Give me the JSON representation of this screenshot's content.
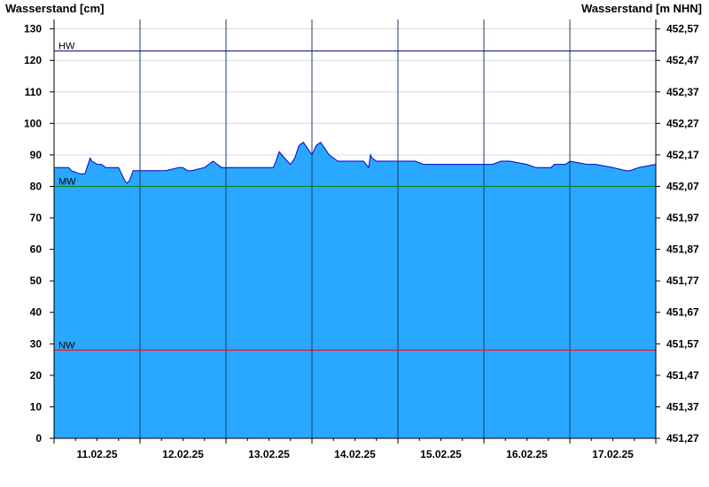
{
  "chart_data": {
    "type": "area",
    "ylabel_left": "Wasserstand [cm]",
    "ylabel_right": "Wasserstand [m NHN]",
    "ylim": [
      0,
      133
    ],
    "yticks_left": [
      0,
      10,
      20,
      30,
      40,
      50,
      60,
      70,
      80,
      90,
      100,
      110,
      120,
      130
    ],
    "yticks_right": [
      "451,27",
      "451,37",
      "451,47",
      "451,57",
      "451,67",
      "451,77",
      "451,87",
      "451,97",
      "452,07",
      "452,17",
      "452,27",
      "452,37",
      "452,47",
      "452,57"
    ],
    "xlim": [
      0,
      7
    ],
    "xtick_labels": [
      "11.02.25",
      "12.02.25",
      "13.02.25",
      "14.02.25",
      "15.02.25",
      "16.02.25",
      "17.02.25"
    ],
    "day_boundaries": [
      1,
      2,
      3,
      4,
      5,
      6
    ],
    "grid": true,
    "reference_lines": [
      {
        "label": "HW",
        "value": 123,
        "color": "#000080"
      },
      {
        "label": "MW",
        "value": 80,
        "color": "#008000"
      },
      {
        "label": "NW",
        "value": 28,
        "color": "#ff0000"
      }
    ],
    "series": [
      {
        "fill": "#2aa8ff",
        "line": "#0000cc",
        "x": [
          0,
          0.17,
          0.2,
          0.3,
          0.36,
          0.42,
          0.44,
          0.5,
          0.55,
          0.6,
          0.65,
          0.75,
          0.82,
          0.85,
          0.88,
          0.92,
          0.95,
          0.99,
          1.1,
          1.3,
          1.45,
          1.5,
          1.55,
          1.6,
          1.75,
          1.8,
          1.85,
          1.9,
          1.95,
          2.0,
          2.2,
          2.4,
          2.5,
          2.55,
          2.58,
          2.62,
          2.68,
          2.75,
          2.8,
          2.85,
          2.9,
          2.95,
          3.0,
          3.05,
          3.1,
          3.15,
          3.2,
          3.25,
          3.3,
          3.5,
          3.6,
          3.66,
          3.68,
          3.7,
          3.75,
          3.8,
          4.0,
          4.2,
          4.3,
          4.4,
          4.6,
          4.8,
          5.0,
          5.1,
          5.2,
          5.3,
          5.5,
          5.6,
          5.7,
          5.78,
          5.82,
          5.86,
          5.95,
          6.0,
          6.2,
          6.3,
          6.5,
          6.65,
          6.7,
          6.8,
          7.0
        ],
        "values": [
          86,
          86,
          85,
          84,
          84,
          89,
          88,
          87,
          87,
          86,
          86,
          86,
          82,
          81,
          82,
          85,
          85,
          85,
          85,
          85,
          86,
          86,
          85,
          85,
          86,
          87,
          88,
          87,
          86,
          86,
          86,
          86,
          86,
          86,
          88,
          91,
          89,
          87,
          89,
          93,
          94,
          92,
          90,
          93,
          94,
          92,
          90,
          89,
          88,
          88,
          88,
          86,
          90,
          89,
          88,
          88,
          88,
          88,
          87,
          87,
          87,
          87,
          87,
          87,
          88,
          88,
          87,
          86,
          86,
          86,
          87,
          87,
          87,
          88,
          87,
          87,
          86,
          85,
          85,
          86,
          87
        ]
      }
    ]
  }
}
